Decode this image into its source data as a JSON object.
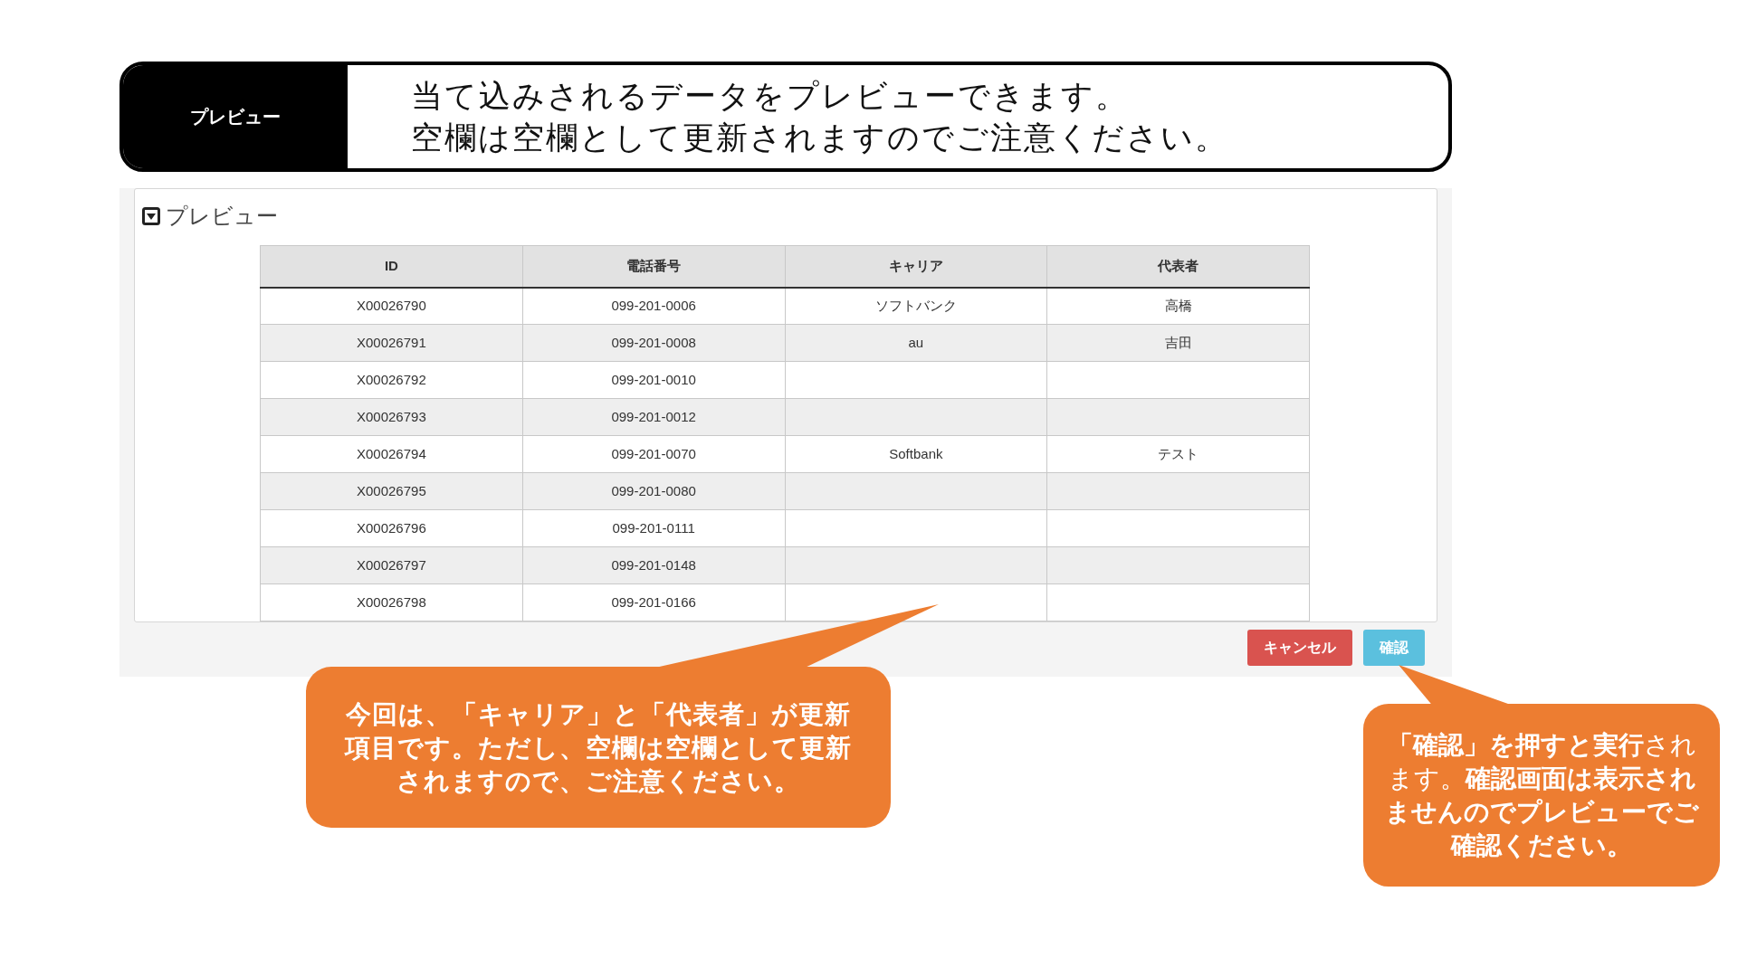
{
  "banner": {
    "label": "プレビュー",
    "lines": [
      "当て込みされるデータをプレビューできます。",
      "空欄は空欄として更新されますのでご注意ください。"
    ]
  },
  "panel": {
    "title": "プレビュー",
    "expanded": true
  },
  "table": {
    "columns": [
      "ID",
      "電話番号",
      "キャリア",
      "代表者"
    ],
    "rows": [
      [
        "X00026790",
        "099-201-0006",
        "ソフトバンク",
        "高橋"
      ],
      [
        "X00026791",
        "099-201-0008",
        "au",
        "吉田"
      ],
      [
        "X00026792",
        "099-201-0010",
        "",
        ""
      ],
      [
        "X00026793",
        "099-201-0012",
        "",
        ""
      ],
      [
        "X00026794",
        "099-201-0070",
        "Softbank",
        "テスト"
      ],
      [
        "X00026795",
        "099-201-0080",
        "",
        ""
      ],
      [
        "X00026796",
        "099-201-0111",
        "",
        ""
      ],
      [
        "X00026797",
        "099-201-0148",
        "",
        ""
      ],
      [
        "X00026798",
        "099-201-0166",
        "",
        ""
      ]
    ]
  },
  "buttons": [
    {
      "label": "キャンセル",
      "kind": "danger"
    },
    {
      "label": "確認",
      "kind": "info"
    }
  ],
  "callouts": [
    {
      "text": "今回は、「キャリア」と「代表者」が更新項目です。ただし、空欄は空欄として更新されますので、ご注意ください。"
    },
    {
      "text": "**「確認」を押すと実行**されます。**確認画面は表示されませんのでプレビューでご確認ください。**"
    }
  ]
}
